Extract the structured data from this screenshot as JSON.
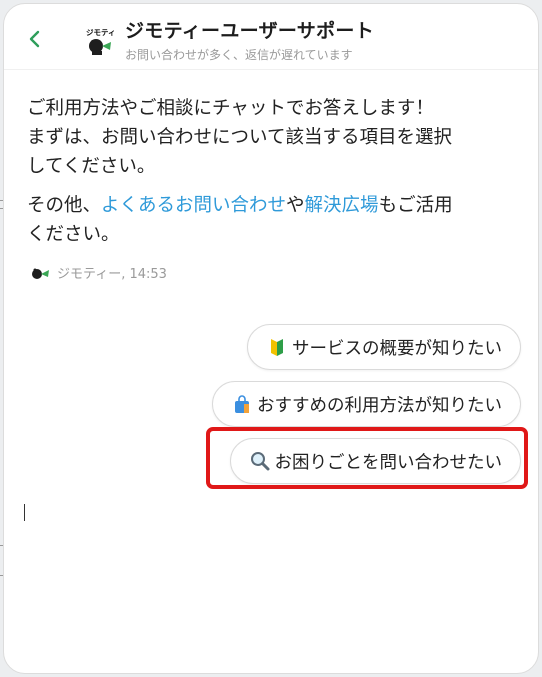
{
  "header": {
    "back_icon": "chevron-left-icon",
    "logo_icon": "jmty-logo-icon",
    "logo_text": "ジモティー",
    "title": "ジモティーユーザーサポート",
    "subtitle": "お問い合わせが多く、返信が遅れています"
  },
  "message": {
    "line1": "ご利用方法やご相談にチャットでお答えします！",
    "line2": "まずは、お問い合わせについて該当する項目を選択",
    "line3": "してください。",
    "p2_prefix": "その他、",
    "faq_link": "よくあるお問い合わせ",
    "p2_mid": "や",
    "forum_link": "解決広場",
    "p2_suffix": "もご活用",
    "p2_line2": "ください。",
    "sender": "ジモティー, 14:53",
    "link_color": "#2f9ad9"
  },
  "quick_replies": [
    {
      "label": "サービスの概要が知りたい",
      "icon": "beginner-mark-icon"
    },
    {
      "label": "おすすめの利用方法が知りたい",
      "icon": "shopping-bag-icon"
    },
    {
      "label": "お困りごとを問い合わせたい",
      "icon": "magnifier-icon"
    }
  ],
  "accent_colors": {
    "back": "#2e9e5b",
    "highlight": "#e01818"
  }
}
